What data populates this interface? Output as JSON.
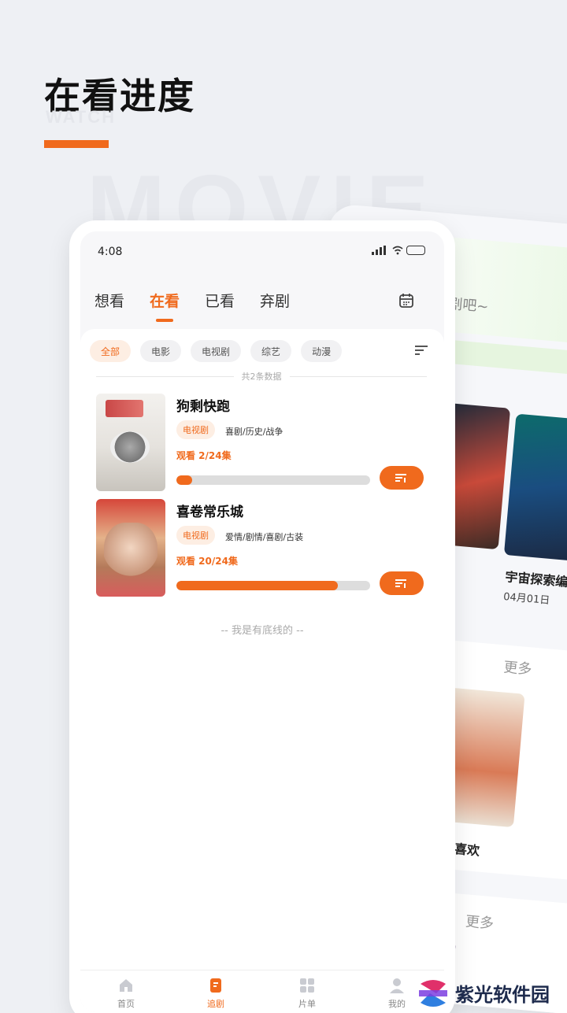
{
  "promo": {
    "headline": "在看进度",
    "headline_sub": "WATCH",
    "watermark": "MOVIE"
  },
  "back_screen": {
    "hint": "剧吧~",
    "item_title": "宇宙探索编",
    "item_date": "04月01日",
    "more_label": "更多",
    "item_title_2": "给我的喜欢",
    "more_label_2": "更多"
  },
  "status_bar": {
    "time": "4:08",
    "icons": [
      "signal-icon",
      "wifi-icon",
      "battery-icon"
    ]
  },
  "tabs": [
    {
      "label": "想看",
      "active": false
    },
    {
      "label": "在看",
      "active": true
    },
    {
      "label": "已看",
      "active": false
    },
    {
      "label": "弃剧",
      "active": false
    }
  ],
  "filters": [
    {
      "label": "全部",
      "active": true
    },
    {
      "label": "电影",
      "active": false
    },
    {
      "label": "电视剧",
      "active": false
    },
    {
      "label": "综艺",
      "active": false
    },
    {
      "label": "动漫",
      "active": false
    }
  ],
  "count_text": "共2条数据",
  "items": [
    {
      "title": "狗剩快跑",
      "type": "电视剧",
      "genre": "喜剧/历史/战争",
      "progress_text": "观看 2/24集",
      "progress": 0.083
    },
    {
      "title": "喜卷常乐城",
      "type": "电视剧",
      "genre": "爱情/剧情/喜剧/古装",
      "progress_text": "观看 20/24集",
      "progress": 0.833
    }
  ],
  "end_text": "-- 我是有底线的 --",
  "nav": [
    {
      "label": "首页",
      "active": false
    },
    {
      "label": "追剧",
      "active": true
    },
    {
      "label": "片单",
      "active": false
    },
    {
      "label": "我的",
      "active": false
    }
  ],
  "brand": {
    "name": "紫光软件园"
  },
  "colors": {
    "accent": "#f06a1d",
    "background": "#eef0f4"
  }
}
